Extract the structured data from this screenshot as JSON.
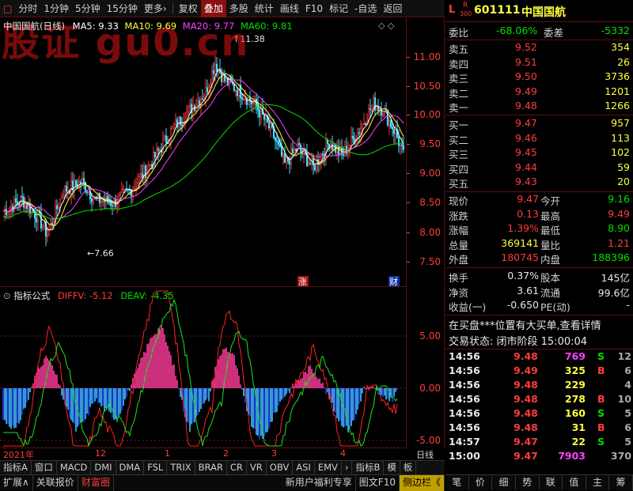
{
  "toolbar": {
    "items": [
      "分时",
      "1分钟",
      "5分钟",
      "15分钟",
      "更多›",
      "复权",
      "叠加",
      "多股",
      "统计",
      "画线",
      "F10",
      "标记",
      "-自选",
      "返回"
    ],
    "active": "叠加"
  },
  "watermark": "股证 gu0.cn",
  "main_chart": {
    "legend_title": "中国国航(日线)",
    "ma": [
      {
        "label": "MA5: 9.33",
        "color": "#ffffff"
      },
      {
        "label": "MA10: 9.69",
        "color": "#ffff40"
      },
      {
        "label": "MA20: 9.77",
        "color": "#ff40ff"
      },
      {
        "label": "MA60: 9.81",
        "color": "#00e000"
      }
    ],
    "high_marker": "11.38",
    "low_marker": "7.66",
    "badge_zhang": "涨",
    "badge_cai": "财",
    "price_ticks": [
      "11.00",
      "10.50",
      "10.00",
      "9.50",
      "9.00",
      "8.50",
      "8.00",
      "7.50"
    ]
  },
  "indicator": {
    "name": "指标公式",
    "diff_label": "DIFFV: -5.12",
    "dea_label": "DEAV: -4.35",
    "ticks": [
      "5.00",
      "0.00",
      "-5.00"
    ]
  },
  "dates": [
    "2021年",
    "12",
    "1",
    "2",
    "3",
    "4"
  ],
  "date_right": "日线",
  "ind_tabs": [
    "指标A",
    "窗口",
    "MACD",
    "DMI",
    "DMA",
    "FSL",
    "TRIX",
    "BRAR",
    "CR",
    "VR",
    "OBV",
    "ASI",
    "EMV",
    "›",
    "指标B",
    "模",
    "板"
  ],
  "bottom_bar": {
    "items": [
      "扩展∧",
      "关联报价",
      "财富圈"
    ],
    "right_items": [
      "新用户福利专享",
      "图文F10",
      "侧边栏《"
    ]
  },
  "quote": {
    "code_prefix": "L",
    "r_tag": "R",
    "r_num": "300",
    "code": "601111",
    "name": "中国国航",
    "weibi_label": "委比",
    "weibi": "-68.06%",
    "weicha_label": "委差",
    "weicha": "-5332",
    "asks": [
      {
        "label": "卖五",
        "price": "9.52",
        "vol": "354"
      },
      {
        "label": "卖四",
        "price": "9.51",
        "vol": "26"
      },
      {
        "label": "卖三",
        "price": "9.50",
        "vol": "3736"
      },
      {
        "label": "卖二",
        "price": "9.49",
        "vol": "1201"
      },
      {
        "label": "卖一",
        "price": "9.48",
        "vol": "1266"
      }
    ],
    "bids": [
      {
        "label": "买一",
        "price": "9.47",
        "vol": "957"
      },
      {
        "label": "买二",
        "price": "9.46",
        "vol": "113"
      },
      {
        "label": "买三",
        "price": "9.45",
        "vol": "102"
      },
      {
        "label": "买四",
        "price": "9.44",
        "vol": "59"
      },
      {
        "label": "买五",
        "price": "9.43",
        "vol": "20"
      }
    ],
    "stats": [
      {
        "l1": "现价",
        "v1": "9.47",
        "c1": "red",
        "l2": "今开",
        "v2": "9.16",
        "c2": "green"
      },
      {
        "l1": "涨跌",
        "v1": "0.13",
        "c1": "red",
        "l2": "最高",
        "v2": "9.49",
        "c2": "red"
      },
      {
        "l1": "涨幅",
        "v1": "1.39%",
        "c1": "red",
        "l2": "最低",
        "v2": "8.90",
        "c2": "green"
      },
      {
        "l1": "总量",
        "v1": "369141",
        "c1": "yellow",
        "l2": "量比",
        "v2": "1.21",
        "c2": "red"
      },
      {
        "l1": "外盘",
        "v1": "180745",
        "c1": "red",
        "l2": "内盘",
        "v2": "188396",
        "c2": "green"
      }
    ],
    "fin": [
      {
        "l1": "换手",
        "v1": "0.37%",
        "l2": "股本",
        "v2": "145亿"
      },
      {
        "l1": "净资",
        "v1": "3.61",
        "l2": "流通",
        "v2": "99.6亿"
      },
      {
        "l1": "收益(一)",
        "v1": "-0.650",
        "l2": "PE(动)",
        "v2": "-"
      }
    ],
    "notice": "在买盘***位置有大买单,查看详情",
    "status": "交易状态: 闭市阶段 15:00:04",
    "ticks": [
      {
        "t": "14:56",
        "p": "9.48",
        "v": "769",
        "vc": "magenta",
        "d": "S",
        "dc": "green",
        "n": "12"
      },
      {
        "t": "14:56",
        "p": "9.49",
        "v": "325",
        "vc": "yellow",
        "d": "B",
        "dc": "red",
        "n": "6"
      },
      {
        "t": "14:56",
        "p": "9.48",
        "v": "229",
        "vc": "yellow",
        "d": "",
        "dc": "white",
        "n": "4"
      },
      {
        "t": "14:56",
        "p": "9.48",
        "v": "278",
        "vc": "yellow",
        "d": "B",
        "dc": "red",
        "n": "10"
      },
      {
        "t": "14:56",
        "p": "9.48",
        "v": "160",
        "vc": "yellow",
        "d": "S",
        "dc": "green",
        "n": "5"
      },
      {
        "t": "14:56",
        "p": "9.48",
        "v": "31",
        "vc": "yellow",
        "d": "B",
        "dc": "red",
        "n": "6"
      },
      {
        "t": "14:57",
        "p": "9.47",
        "v": "22",
        "vc": "yellow",
        "d": "S",
        "dc": "green",
        "n": "5"
      },
      {
        "t": "15:00",
        "p": "9.47",
        "v": "7903",
        "vc": "magenta",
        "d": "",
        "dc": "white",
        "n": "370"
      }
    ],
    "side_tabs": [
      "笔",
      "价",
      "细",
      "势",
      "联",
      "值",
      "主",
      "筹"
    ]
  }
}
